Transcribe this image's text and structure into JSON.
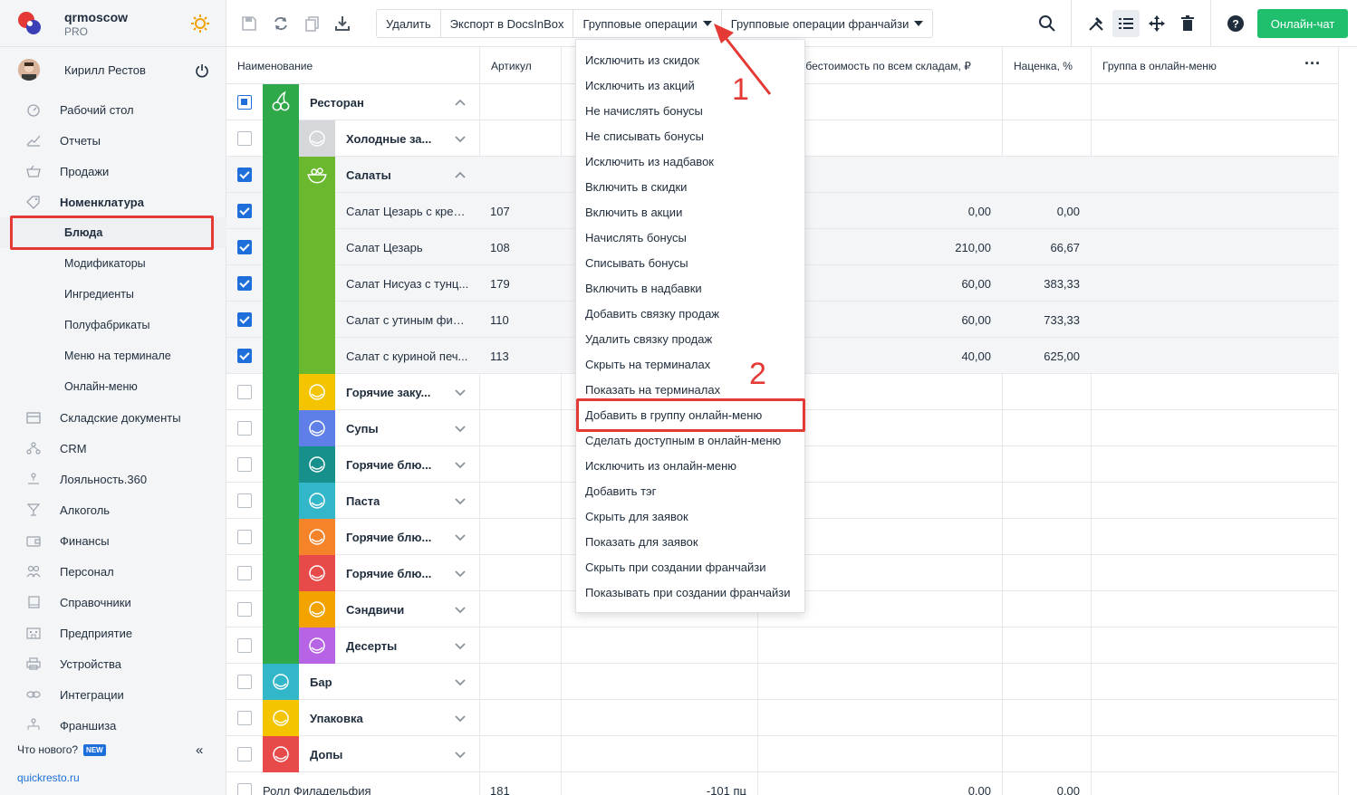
{
  "header": {
    "org_name": "qrmoscow",
    "plan": "PRO",
    "user_name": "Кирилл Рестов"
  },
  "sidebar": {
    "items": [
      {
        "label": "Рабочий стол",
        "icon": "dashboard-icon"
      },
      {
        "label": "Отчеты",
        "icon": "reports-icon"
      },
      {
        "label": "Продажи",
        "icon": "basket-icon"
      },
      {
        "label": "Номенклатура",
        "icon": "tag-icon"
      },
      {
        "label": "Блюда",
        "icon": ""
      },
      {
        "label": "Модификаторы",
        "icon": ""
      },
      {
        "label": "Ингредиенты",
        "icon": ""
      },
      {
        "label": "Полуфабрикаты",
        "icon": ""
      },
      {
        "label": "Меню на терминале",
        "icon": ""
      },
      {
        "label": "Онлайн-меню",
        "icon": ""
      },
      {
        "label": "Складские документы",
        "icon": "warehouse-icon"
      },
      {
        "label": "CRM",
        "icon": "crm-icon"
      },
      {
        "label": "Лояльность.360",
        "icon": "loyalty-icon"
      },
      {
        "label": "Алкоголь",
        "icon": "glass-icon"
      },
      {
        "label": "Финансы",
        "icon": "wallet-icon"
      },
      {
        "label": "Персонал",
        "icon": "people-icon"
      },
      {
        "label": "Справочники",
        "icon": "book-icon"
      },
      {
        "label": "Предприятие",
        "icon": "building-icon"
      },
      {
        "label": "Устройства",
        "icon": "printer-icon"
      },
      {
        "label": "Интеграции",
        "icon": "link-icon"
      },
      {
        "label": "Франшиза",
        "icon": "franchise-icon"
      }
    ],
    "whats_new": "Что нового?",
    "new_badge": "NEW",
    "site": "quickresto.ru"
  },
  "toolbar": {
    "delete": "Удалить",
    "export": "Экспорт в DocsInBox",
    "group_ops": "Групповые операции",
    "group_ops_franchise": "Групповые операции франчайзи",
    "online_chat": "Онлайн-чат"
  },
  "table": {
    "columns": {
      "name": "Наименование",
      "article": "Артикул",
      "cost": "ля себестоимость по всем складам, ₽",
      "markup": "Наценка, %",
      "online_group": "Группа в онлайн-меню"
    },
    "rows": [
      {
        "name": "Ресторан",
        "article": "",
        "cost": "",
        "markup": ""
      },
      {
        "name": "Холодные за...",
        "article": "",
        "cost": "",
        "markup": ""
      },
      {
        "name": "Салаты",
        "article": "",
        "cost": "",
        "markup": ""
      },
      {
        "name": "Салат Цезарь с крев...",
        "article": "107",
        "cost": "0,00",
        "markup": "0,00"
      },
      {
        "name": "Салат Цезарь",
        "article": "108",
        "cost": "210,00",
        "markup": "66,67"
      },
      {
        "name": "Салат Нисуаз с тунц...",
        "article": "179",
        "cost": "60,00",
        "markup": "383,33"
      },
      {
        "name": "Салат с утиным фил...",
        "article": "110",
        "cost": "60,00",
        "markup": "733,33"
      },
      {
        "name": "Салат с куриной печ...",
        "article": "113",
        "cost": "40,00",
        "markup": "625,00"
      },
      {
        "name": "Горячие заку...",
        "article": "",
        "cost": "",
        "markup": ""
      },
      {
        "name": "Супы",
        "article": "",
        "cost": "",
        "markup": ""
      },
      {
        "name": "Горячие блю...",
        "article": "",
        "cost": "",
        "markup": ""
      },
      {
        "name": "Паста",
        "article": "",
        "cost": "",
        "markup": ""
      },
      {
        "name": "Горячие блю...",
        "article": "",
        "cost": "",
        "markup": ""
      },
      {
        "name": "Горячие блю...",
        "article": "",
        "cost": "",
        "markup": ""
      },
      {
        "name": "Сэндвичи",
        "article": "",
        "cost": "",
        "markup": ""
      },
      {
        "name": "Десерты",
        "article": "",
        "cost": "",
        "markup": ""
      },
      {
        "name": "Бар",
        "article": "",
        "cost": "",
        "markup": ""
      },
      {
        "name": "Упаковка",
        "article": "",
        "cost": "",
        "markup": ""
      },
      {
        "name": "Допы",
        "article": "",
        "cost": "",
        "markup": ""
      },
      {
        "name": "Ролл Филадельфия",
        "article": "181",
        "qty": "-101 пц",
        "cost": "0,00",
        "markup": "0,00"
      }
    ]
  },
  "dropdown": {
    "items": [
      "Исключить из скидок",
      "Исключить из акций",
      "Не начислять бонусы",
      "Не списывать бонусы",
      "Исключить из надбавок",
      "Включить в скидки",
      "Включить в акции",
      "Начислять бонусы",
      "Списывать бонусы",
      "Включить в надбавки",
      "Добавить связку продаж",
      "Удалить связку продаж",
      "Скрыть на терминалах",
      "Показать на терминалах",
      "Добавить в группу онлайн-меню",
      "Сделать доступным в онлайн-меню",
      "Исключить из онлайн-меню",
      "Добавить тэг",
      "Скрыть для заявок",
      "Показать для заявок",
      "Скрыть при создании франчайзи",
      "Показывать при создании франчайзи"
    ]
  },
  "annotations": {
    "step1": "1",
    "step2": "2"
  },
  "colors": {
    "accent": "#1e6fd9",
    "chat_green": "#1fbf6e",
    "highlight_red": "#e53935",
    "restaurant_green": "#2fa84a",
    "salads_green": "#6ab82e"
  }
}
